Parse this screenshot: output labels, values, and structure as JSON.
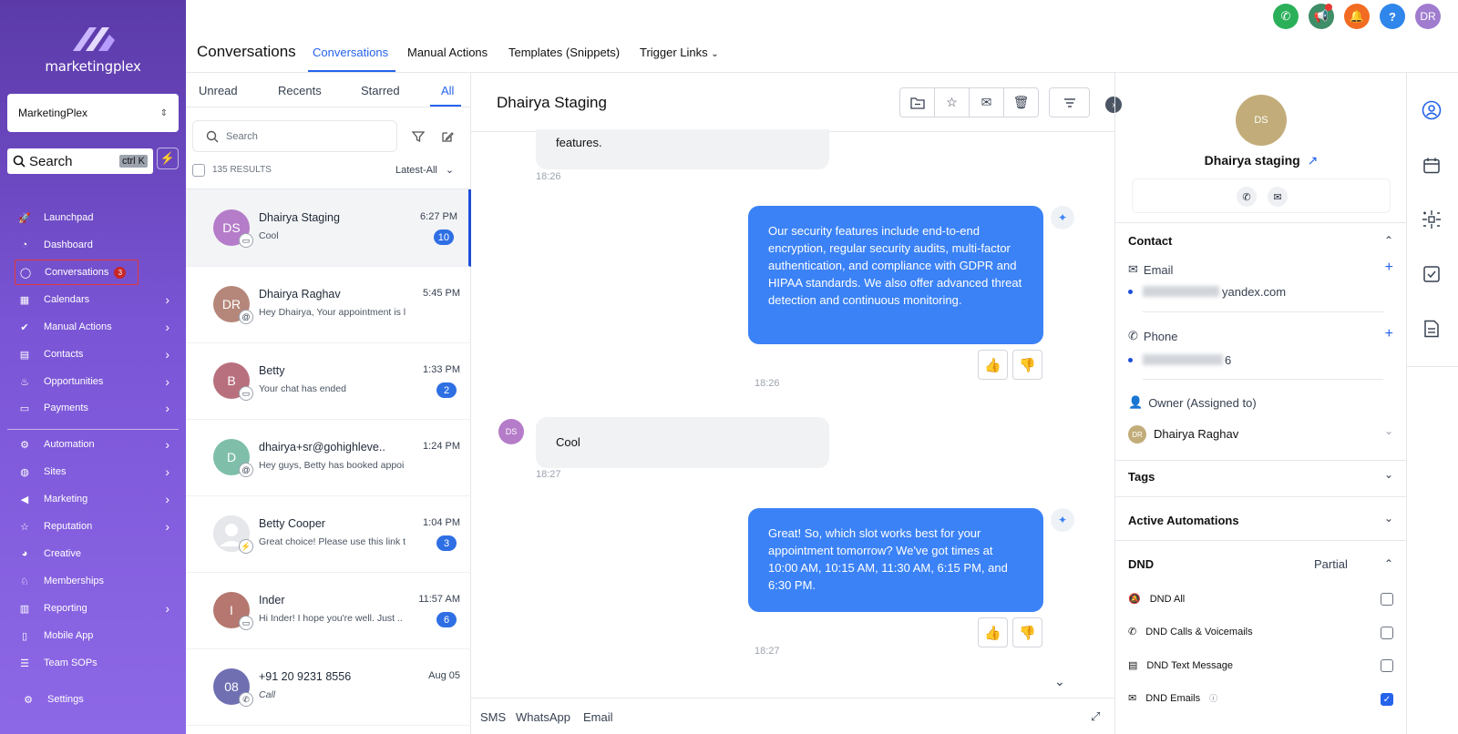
{
  "brand": {
    "logo_text": "marketingplex",
    "logo_icon": "marketingplex-logo"
  },
  "account": {
    "name": "MarketingPlex"
  },
  "sidebar_search": {
    "label": "Search",
    "shortcut": "ctrl K"
  },
  "nav": [
    {
      "label": "Launchpad",
      "icon": "rocket-icon"
    },
    {
      "label": "Dashboard",
      "icon": "gauge-icon"
    },
    {
      "label": "Conversations",
      "icon": "chat-icon",
      "badge": "3"
    },
    {
      "label": "Calendars",
      "icon": "calendar-icon"
    },
    {
      "label": "Manual Actions",
      "icon": "check-circle-icon"
    },
    {
      "label": "Contacts",
      "icon": "contact-book-icon"
    },
    {
      "label": "Opportunities",
      "icon": "flame-icon"
    },
    {
      "label": "Payments",
      "icon": "card-icon"
    },
    {
      "label": "Automation",
      "icon": "automation-icon"
    },
    {
      "label": "Sites",
      "icon": "globe-icon"
    },
    {
      "label": "Marketing",
      "icon": "megaphone-icon"
    },
    {
      "label": "Reputation",
      "icon": "star-icon"
    },
    {
      "label": "Creative",
      "icon": "palette-icon"
    },
    {
      "label": "Memberships",
      "icon": "award-icon"
    },
    {
      "label": "Reporting",
      "icon": "chart-icon"
    },
    {
      "label": "Mobile App",
      "icon": "phone-icon"
    },
    {
      "label": "Team SOPs",
      "icon": "list-icon"
    },
    {
      "label": "Settings",
      "icon": "gear-icon"
    }
  ],
  "header": {
    "title": "Conversations",
    "tabs": [
      "Conversations",
      "Manual Actions",
      "Templates (Snippets)",
      "Trigger Links"
    ],
    "user_initials": "DR"
  },
  "list": {
    "filter_tabs": [
      "Unread",
      "Recents",
      "Starred",
      "All"
    ],
    "search_placeholder": "Search",
    "results": "135 RESULTS",
    "sort": "Latest-All",
    "items": [
      {
        "initials": "DS",
        "name": "Dhairya Staging",
        "preview": "Cool",
        "time": "6:27 PM",
        "badge": "10",
        "avatar_color": "#b57cc9",
        "channel": "chat-icon"
      },
      {
        "initials": "DR",
        "name": "Dhairya Raghav",
        "preview": "Hey Dhairya, Your appointment is l",
        "time": "5:45 PM",
        "badge": "",
        "avatar_color": "#b5877a",
        "channel": "email-icon"
      },
      {
        "initials": "B",
        "name": "Betty",
        "preview": "Your chat has ended",
        "time": "1:33 PM",
        "badge": "2",
        "avatar_color": "#b9707e",
        "channel": "chat-icon"
      },
      {
        "initials": "D",
        "name": "dhairya+sr@gohighleve..",
        "preview": "Hey guys, Betty has booked appoi",
        "time": "1:24 PM",
        "badge": "",
        "avatar_color": "#7fbfa9",
        "channel": "email-icon"
      },
      {
        "initials": "",
        "name": "Betty Cooper",
        "preview": "Great choice! Please use this link t",
        "time": "1:04 PM",
        "badge": "3",
        "avatar_color": "#d1d5db",
        "channel": "messenger-icon"
      },
      {
        "initials": "I",
        "name": "Inder",
        "preview": "Hi Inder! I hope you're well. Just ..",
        "time": "11:57 AM",
        "badge": "6",
        "avatar_color": "#b5776f",
        "channel": "chat-icon"
      },
      {
        "initials": "08",
        "name": "+91 20 9231 8556",
        "preview": "Call",
        "time": "Aug 05",
        "badge": "",
        "avatar_color": "#6f6fb2",
        "channel": "phone-icon"
      }
    ]
  },
  "chat": {
    "title": "Dhairya Staging",
    "messages": [
      {
        "dir": "in",
        "text": "features.",
        "time": "18:26"
      },
      {
        "dir": "out",
        "text": "Our security features include end-to-end encryption, regular security audits, multi-factor authentication, and compliance with GDPR and HIPAA standards. We also offer advanced threat detection and continuous monitoring.",
        "time": "18:26"
      },
      {
        "dir": "in",
        "text": "Cool",
        "time": "18:27",
        "avatar": "DS"
      },
      {
        "dir": "out",
        "text": "Great! So, which slot works best for your appointment tomorrow? We've got times at 10:00 AM, 10:15 AM, 11:30 AM, 6:15 PM, and 6:30 PM.",
        "time": "18:27"
      }
    ],
    "channels": [
      "SMS",
      "WhatsApp",
      "Email"
    ]
  },
  "contact": {
    "initials": "DS",
    "name": "Dhairya staging",
    "section": "Contact",
    "email_label": "Email",
    "email_value": "yandex.com",
    "phone_label": "Phone",
    "phone_value": "6",
    "owner_label": "Owner (Assigned to)",
    "owner_initials": "DR",
    "owner_name": "Dhairya Raghav",
    "tags": "Tags",
    "automations": "Active Automations",
    "dnd": "DND",
    "dnd_status": "Partial",
    "dnd_items": [
      {
        "label": "DND All",
        "checked": false
      },
      {
        "label": "DND Calls & Voicemails",
        "checked": false
      },
      {
        "label": "DND Text Message",
        "checked": false
      },
      {
        "label": "DND Emails",
        "checked": true
      }
    ]
  },
  "colors": {
    "accent": "#2563eb",
    "bubble_out": "#3b82f6",
    "sidebar_top": "#5b3aa8",
    "sidebar_bottom": "#8d68e6"
  }
}
